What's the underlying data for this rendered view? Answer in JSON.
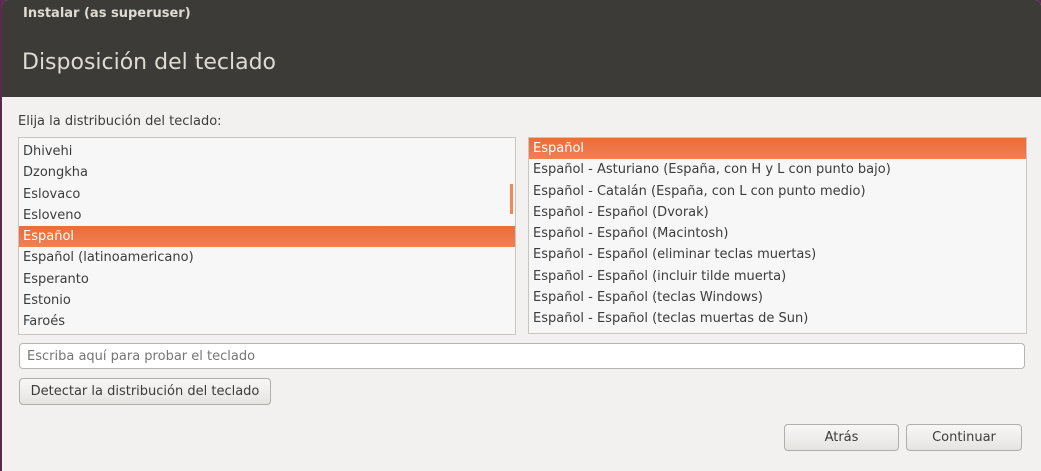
{
  "window": {
    "title": "Instalar (as superuser)"
  },
  "page": {
    "title": "Disposición del teclado",
    "prompt": "Elija la distribución del teclado:"
  },
  "layouts": [
    "Dhivehi",
    "Dzongkha",
    "Eslovaco",
    "Esloveno",
    "Español",
    "Español (latinoamericano)",
    "Esperanto",
    "Estonio",
    "Faroés"
  ],
  "layouts_selected": "Español",
  "variants": [
    "Español",
    "Español - Asturiano (España, con H y L con punto bajo)",
    "Español - Catalán (España, con L con punto medio)",
    "Español - Español (Dvorak)",
    "Español - Español (Macintosh)",
    "Español - Español (eliminar teclas muertas)",
    "Español - Español (incluir tilde muerta)",
    "Español - Español (teclas Windows)",
    "Español - Español (teclas muertas de Sun)"
  ],
  "variants_selected": "Español",
  "test_input": {
    "placeholder": "Escriba aquí para probar el teclado",
    "value": ""
  },
  "buttons": {
    "detect": "Detectar la distribución del teclado",
    "back": "Atrás",
    "continue": "Continuar"
  },
  "colors": {
    "accent": "#ec6c3b",
    "header": "#3c3b37"
  }
}
